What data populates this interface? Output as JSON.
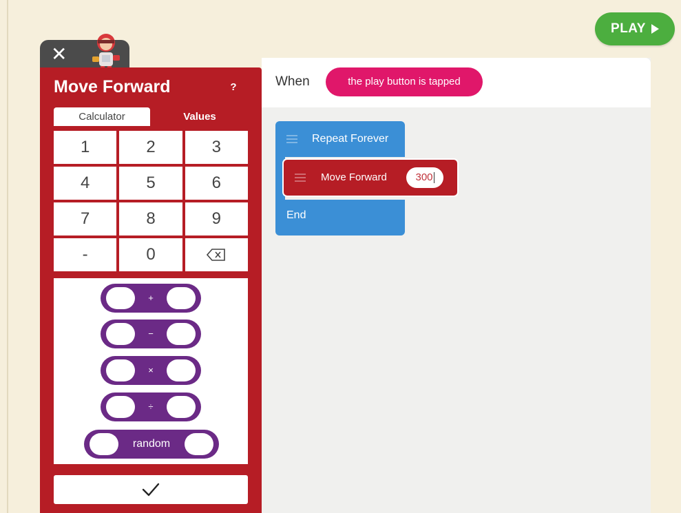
{
  "play_button": {
    "label": "PLAY",
    "icon": "play-triangle-icon"
  },
  "close_tab": {
    "close_label": "✕",
    "character_icon": "robot-character-icon"
  },
  "panel": {
    "title": "Move Forward",
    "help_label": "?",
    "tabs": [
      {
        "label": "Calculator",
        "selected": true
      },
      {
        "label": "Values",
        "selected": false
      }
    ],
    "keypad": [
      "1",
      "2",
      "3",
      "4",
      "5",
      "6",
      "7",
      "8",
      "9",
      "-",
      "0"
    ],
    "backspace_icon": "backspace-icon",
    "operators": [
      {
        "symbol": "+"
      },
      {
        "symbol": "−"
      },
      {
        "symbol": "×"
      },
      {
        "symbol": "÷"
      },
      {
        "symbol": "random"
      }
    ],
    "confirm_icon": "checkmark-icon",
    "color": "#b61d25"
  },
  "canvas": {
    "when_label": "When",
    "trigger": "the play button is tapped",
    "repeat_label": "Repeat Forever",
    "end_label": "End",
    "move_label": "Move Forward",
    "move_value": "300"
  },
  "colors": {
    "background": "#f6efdc",
    "play": "#4cae3f",
    "trigger": "#e0176a",
    "control_block": "#3b8fd6",
    "move_block": "#b61d25",
    "operator": "#6b2a86"
  }
}
